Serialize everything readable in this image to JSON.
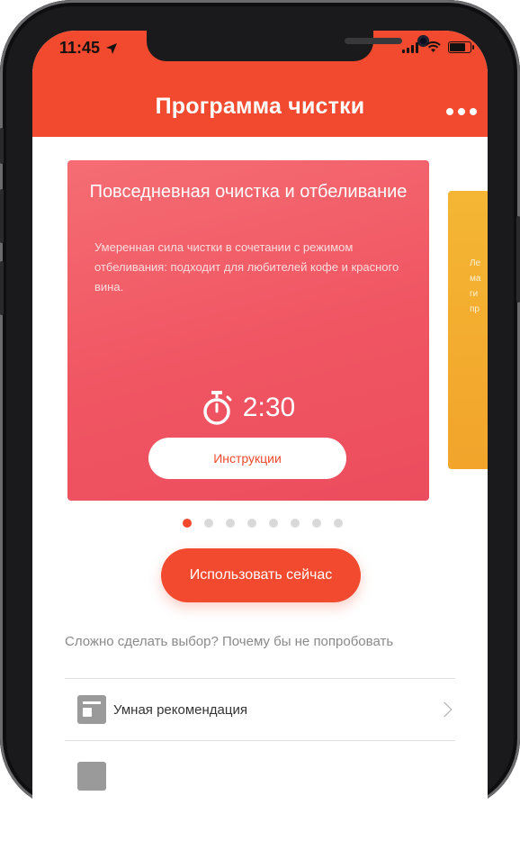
{
  "status": {
    "time": "11:45",
    "battery_percent": 0.8
  },
  "header": {
    "title": "Программа чистки"
  },
  "card": {
    "title": "Повседневная очистка и отбеливание",
    "description": "Умеренная сила чистки в сочетании с режимом отбеливания: подходит для любителей кофе и красного вина.",
    "time": "2:30",
    "instructions_label": "Инструкции"
  },
  "next_card": {
    "text": [
      "Ле",
      "ма",
      "ги",
      "пр"
    ]
  },
  "carousel": {
    "total": 8,
    "active_index": 0
  },
  "use_now_label": "Использовать сейчас",
  "prompt": "Сложно сделать выбор? Почему бы не попробовать",
  "list": [
    {
      "label": "Умная рекомендация",
      "icon": "thumbs-up-document-icon"
    }
  ],
  "colors": {
    "accent": "#f24a2e",
    "card": "#f05562",
    "card_next": "#f2a42b"
  }
}
